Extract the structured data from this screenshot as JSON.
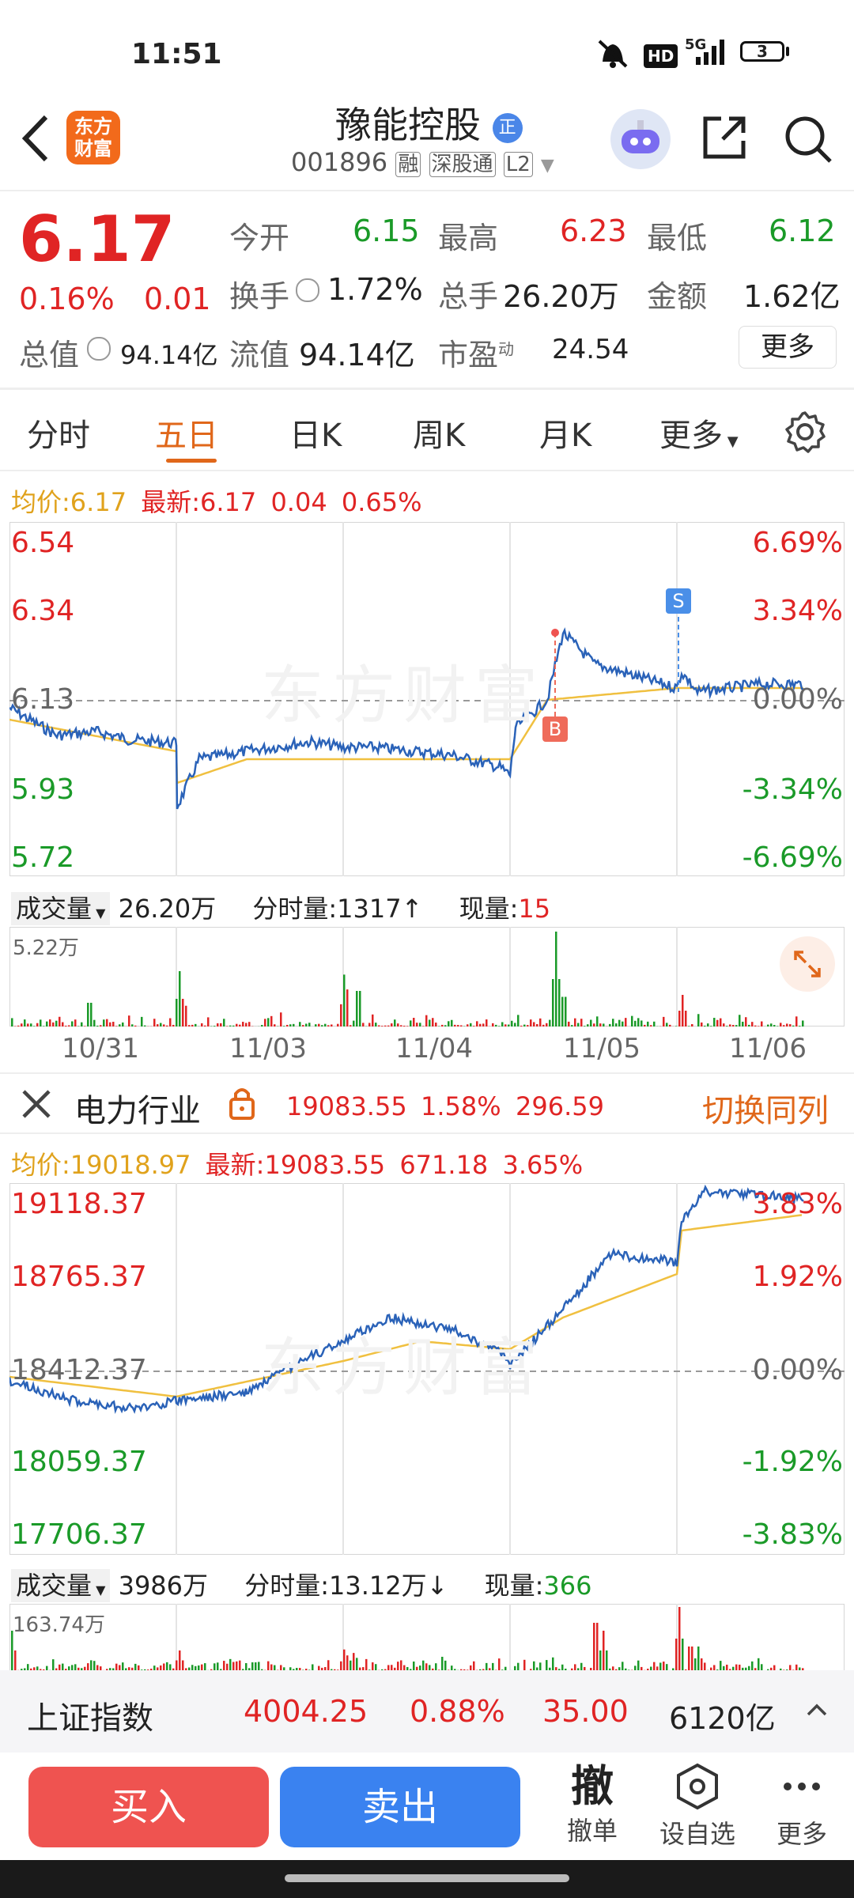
{
  "status": {
    "time": "11:51",
    "network": "5G",
    "battery": "3"
  },
  "header": {
    "title": "豫能控股",
    "title_badge": "正",
    "code": "001896",
    "tags": [
      "融",
      "深股通",
      "L2"
    ],
    "logo_text": "东方\n财富"
  },
  "quote": {
    "price": "6.17",
    "change_pct": "0.16%",
    "change": "0.01",
    "open_label": "今开",
    "open": "6.15",
    "high_label": "最高",
    "high": "6.23",
    "low_label": "最低",
    "low": "6.12",
    "turnover_label": "换手",
    "turnover": "1.72%",
    "volume_label": "总手",
    "volume": "26.20万",
    "amount_label": "金额",
    "amount": "1.62亿",
    "mktcap_label": "总值",
    "mktcap": "94.14亿",
    "float_label": "流值",
    "float": "94.14亿",
    "pe_label": "市盈",
    "pe_sup": "动",
    "pe": "24.54",
    "more_button": "更多"
  },
  "tabs": [
    "分时",
    "五日",
    "日K",
    "周K",
    "月K",
    "更多"
  ],
  "active_tab": "五日",
  "chart1": {
    "avg_label": "均价:",
    "avg": "6.17",
    "last_label": "最新:",
    "last": "6.17",
    "last_change": "0.04",
    "last_pct": "0.65%",
    "y_left": [
      "6.54",
      "6.34",
      "6.13",
      "5.93",
      "5.72"
    ],
    "y_right": [
      "6.69%",
      "3.34%",
      "0.00%",
      "-3.34%",
      "-6.69%"
    ],
    "markers": {
      "sell": "S",
      "buy": "B"
    },
    "vol_label": "成交量",
    "vol_value": "26.20万",
    "tick_label": "分时量:",
    "tick_value": "1317",
    "tick_arrow": "↑",
    "now_label": "现量:",
    "now_value": "15",
    "vol_max": "5.22万",
    "dates": [
      "10/31",
      "11/03",
      "11/04",
      "11/05",
      "11/06"
    ]
  },
  "sector": {
    "name": "电力行业",
    "price": "19083.55",
    "pct": "1.58%",
    "change": "296.59",
    "switch": "切换同列"
  },
  "chart2": {
    "avg_label": "均价:",
    "avg": "19018.97",
    "last_label": "最新:",
    "last": "19083.55",
    "last_change": "671.18",
    "last_pct": "3.65%",
    "y_left": [
      "19118.37",
      "18765.37",
      "18412.37",
      "18059.37",
      "17706.37"
    ],
    "y_right": [
      "3.83%",
      "1.92%",
      "0.00%",
      "-1.92%",
      "-3.83%"
    ],
    "vol_label": "成交量",
    "vol_value": "3986万",
    "tick_label": "分时量:",
    "tick_value": "13.12万",
    "tick_arrow": "↓",
    "now_label": "现量:",
    "now_value": "366",
    "vol_max": "163.74万"
  },
  "index_bar": {
    "name": "上证指数",
    "value": "4004.25",
    "pct": "0.88%",
    "change": "35.00",
    "amount": "6120亿"
  },
  "bottom": {
    "buy": "买入",
    "sell": "卖出",
    "cancel_glyph": "撤",
    "cancel": "撤单",
    "watch": "设自选",
    "more": "更多"
  },
  "colors": {
    "up": "#e02424",
    "down": "#1a9a28",
    "accent": "#e0671a",
    "price_line": "#2a62b8",
    "avg_line": "#f0c040",
    "buy": "#ef5350",
    "sell": "#3a82f0"
  }
}
